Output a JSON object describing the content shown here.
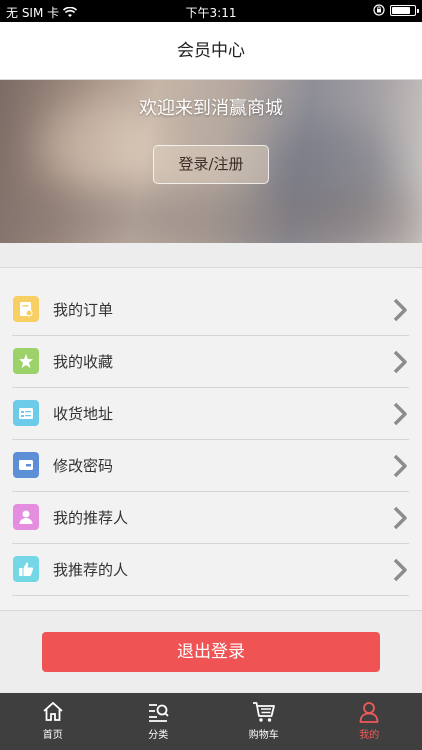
{
  "status_bar": {
    "carrier": "无 SIM 卡",
    "time": "下午3:11",
    "battery_percent": 85
  },
  "navbar": {
    "title": "会员中心"
  },
  "hero": {
    "welcome": "欢迎来到消赢商城",
    "login_button": "登录/注册"
  },
  "menu": {
    "items": [
      {
        "label": "我的订单",
        "icon": "order-icon",
        "color": "#f7cf63"
      },
      {
        "label": "我的收藏",
        "icon": "star-icon",
        "color": "#9dd16a"
      },
      {
        "label": "收货地址",
        "icon": "address-icon",
        "color": "#6ccbe8"
      },
      {
        "label": "修改密码",
        "icon": "card-icon",
        "color": "#5d8fd6"
      },
      {
        "label": "我的推荐人",
        "icon": "person-icon",
        "color": "#e58ee0"
      },
      {
        "label": "我推荐的人",
        "icon": "thumbs-up-icon",
        "color": "#74d7e6"
      }
    ]
  },
  "logout": {
    "label": "退出登录",
    "color": "#f05353"
  },
  "tabbar": {
    "tabs": [
      {
        "label": "首页",
        "icon": "home-icon"
      },
      {
        "label": "分类",
        "icon": "category-search-icon"
      },
      {
        "label": "购物车",
        "icon": "cart-icon"
      },
      {
        "label": "我的",
        "icon": "user-icon",
        "active": true,
        "active_color": "#f05a5a"
      }
    ]
  }
}
